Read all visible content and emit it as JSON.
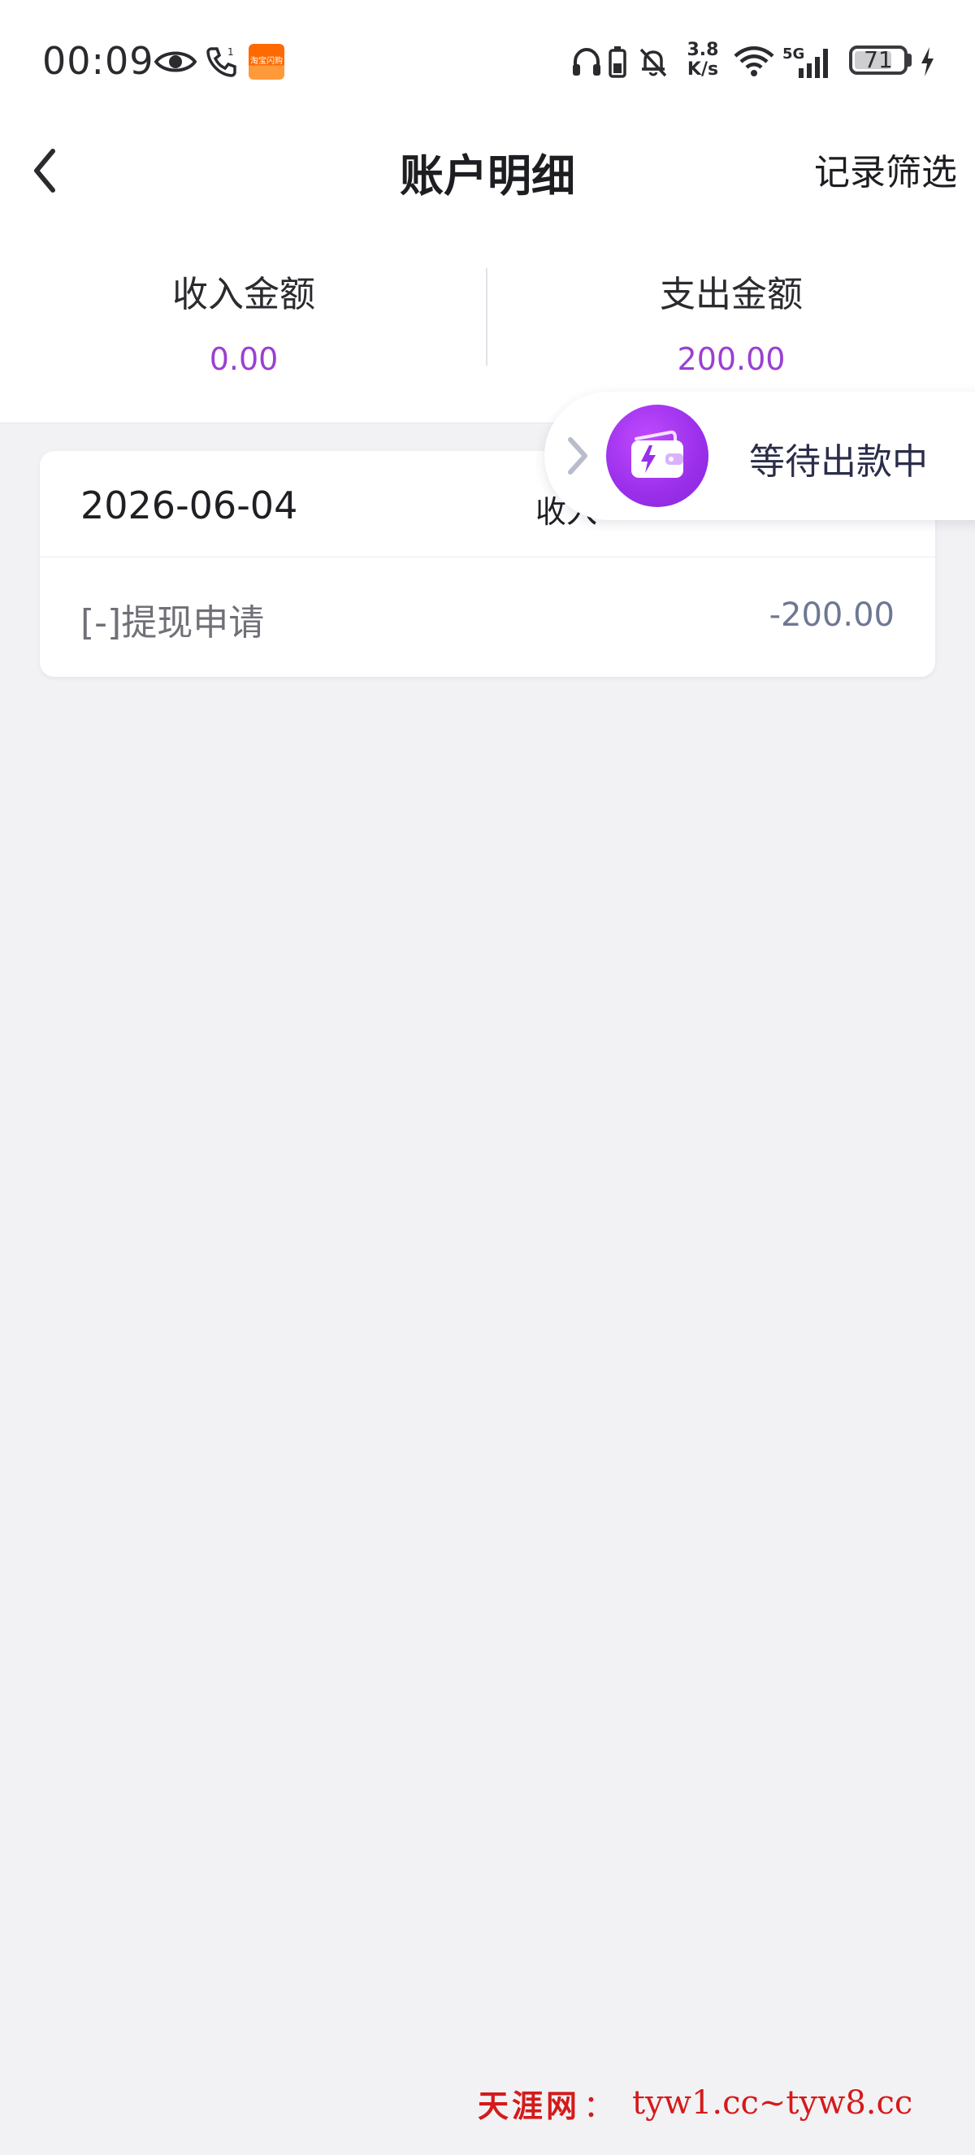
{
  "status_bar": {
    "time": "00:09",
    "net_speed_value": "3.8",
    "net_speed_unit": "K/s",
    "network_type": "5G",
    "battery_level": "71",
    "taobao_badge": "淘宝闪购",
    "icons": [
      "eye-icon",
      "call-icon",
      "taobao-app-icon",
      "headphones-icon",
      "battery-saver-icon",
      "bell-off-icon",
      "wifi-icon",
      "signal-icon",
      "battery-icon",
      "charging-icon"
    ]
  },
  "header": {
    "title": "账户明细",
    "filter_label": "记录筛选"
  },
  "summary": {
    "income_label": "收入金额",
    "income_value": "0.00",
    "expense_label": "支出金额",
    "expense_value": "200.00",
    "value_color": "#9b3fd1"
  },
  "records": [
    {
      "date": "2026-06-04",
      "type_partial": "收入",
      "description": "[-]提现申请",
      "amount": "-200.00"
    }
  ],
  "pending_pill": {
    "label": "等待出款中",
    "icon": "wallet-icon"
  },
  "watermark": {
    "name": "天涯网",
    "colon": "：",
    "url": "tyw1.cc~tyw8.cc"
  }
}
